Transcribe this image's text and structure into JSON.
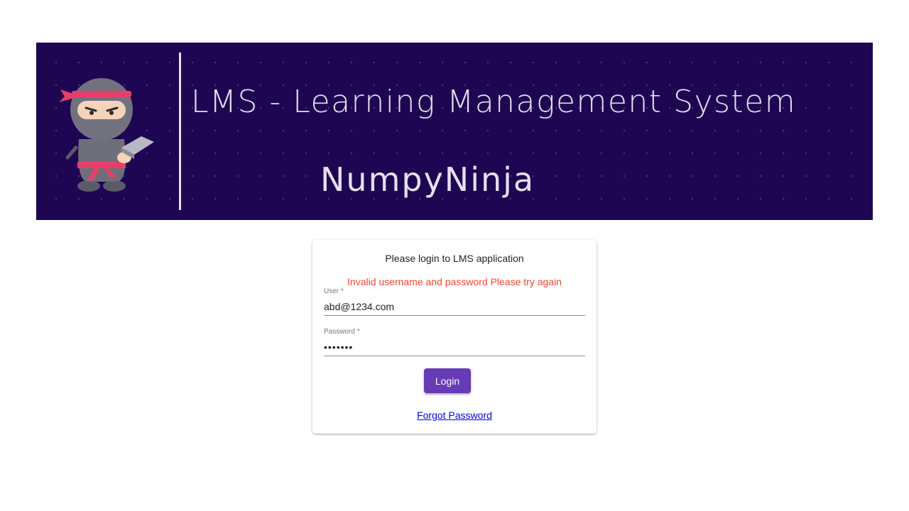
{
  "banner": {
    "title": "LMS - Learning Management System",
    "brand": "NumpyNinja",
    "logo_icon": "ninja-mascot-with-laptop",
    "background_color": "#1e0652"
  },
  "login": {
    "heading": "Please login to LMS application",
    "error_message": "Invalid username and password Please try again",
    "user_label": "User *",
    "user_value": "abd@1234.com",
    "password_label": "Password *",
    "password_value": "•••••••",
    "login_button": "Login",
    "forgot_password": "Forgot Password",
    "accent_color": "#673ab7",
    "error_color": "#f44336"
  }
}
